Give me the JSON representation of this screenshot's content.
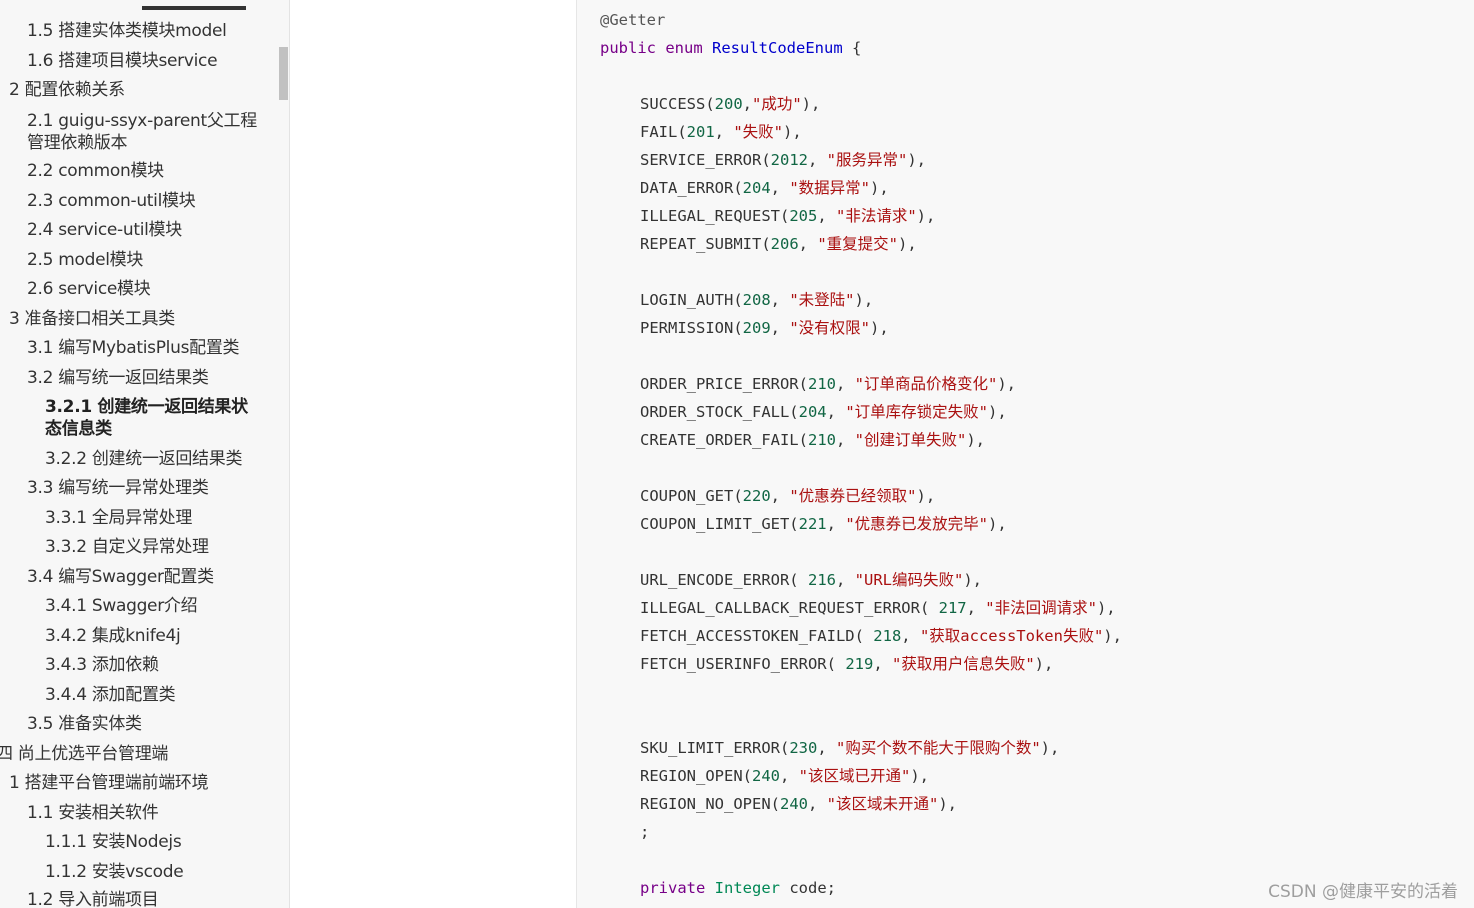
{
  "toc": {
    "items": [
      {
        "label": "1.5 搭建实体类模块model"
      },
      {
        "label": "1.6 搭建项目模块service"
      },
      {
        "label": "2 配置依赖关系"
      },
      {
        "label": "2.1 guigu-ssyx-parent父工程管理依赖版本"
      },
      {
        "label": "2.2 common模块"
      },
      {
        "label": "2.3 common-util模块"
      },
      {
        "label": "2.4 service-util模块"
      },
      {
        "label": "2.5 model模块"
      },
      {
        "label": "2.6 service模块"
      },
      {
        "label": "3 准备接口相关工具类"
      },
      {
        "label": "3.1 编写MybatisPlus配置类"
      },
      {
        "label": "3.2 编写统一返回结果类"
      },
      {
        "label": "3.2.1 创建统一返回结果状态信息类"
      },
      {
        "label": "3.2.2 创建统一返回结果类"
      },
      {
        "label": "3.3 编写统一异常处理类"
      },
      {
        "label": "3.3.1 全局异常处理"
      },
      {
        "label": "3.3.2 自定义异常处理"
      },
      {
        "label": "3.4 编写Swagger配置类"
      },
      {
        "label": "3.4.1 Swagger介绍"
      },
      {
        "label": "3.4.2 集成knife4j"
      },
      {
        "label": "3.4.3 添加依赖"
      },
      {
        "label": "3.4.4 添加配置类"
      },
      {
        "label": "3.5 准备实体类"
      },
      {
        "label": "四 尚上优选平台管理端"
      },
      {
        "label": "1 搭建平台管理端前端环境"
      },
      {
        "label": "1.1 安装相关软件"
      },
      {
        "label": "1.1.1 安装Nodejs"
      },
      {
        "label": "1.1.2 安装vscode"
      },
      {
        "label": "1.2 导入前端项目"
      }
    ]
  },
  "code": {
    "annotation": "@Getter",
    "decl_public": "public",
    "decl_enum": "enum",
    "decl_name": "ResultCodeEnum",
    "decl_brace": "{",
    "entries": [
      {
        "name": "SUCCESS(",
        "num": "200",
        "sep": ",",
        "str": "\"成功\"",
        "end": "),"
      },
      {
        "name": "FAIL(",
        "num": "201",
        "sep": ", ",
        "str": "\"失败\"",
        "end": "),"
      },
      {
        "name": "SERVICE_ERROR(",
        "num": "2012",
        "sep": ", ",
        "str": "\"服务异常\"",
        "end": "),"
      },
      {
        "name": "DATA_ERROR(",
        "num": "204",
        "sep": ", ",
        "str": "\"数据异常\"",
        "end": "),"
      },
      {
        "name": "ILLEGAL_REQUEST(",
        "num": "205",
        "sep": ", ",
        "str": "\"非法请求\"",
        "end": "),"
      },
      {
        "name": "REPEAT_SUBMIT(",
        "num": "206",
        "sep": ", ",
        "str": "\"重复提交\"",
        "end": "),"
      },
      {
        "name": "LOGIN_AUTH(",
        "num": "208",
        "sep": ", ",
        "str": "\"未登陆\"",
        "end": "),"
      },
      {
        "name": "PERMISSION(",
        "num": "209",
        "sep": ", ",
        "str": "\"没有权限\"",
        "end": "),"
      },
      {
        "name": "ORDER_PRICE_ERROR(",
        "num": "210",
        "sep": ", ",
        "str": "\"订单商品价格变化\"",
        "end": "),"
      },
      {
        "name": "ORDER_STOCK_FALL(",
        "num": "204",
        "sep": ", ",
        "str": "\"订单库存锁定失败\"",
        "end": "),"
      },
      {
        "name": "CREATE_ORDER_FAIL(",
        "num": "210",
        "sep": ", ",
        "str": "\"创建订单失败\"",
        "end": "),"
      },
      {
        "name": "COUPON_GET(",
        "num": "220",
        "sep": ", ",
        "str": "\"优惠券已经领取\"",
        "end": "),"
      },
      {
        "name": "COUPON_LIMIT_GET(",
        "num": "221",
        "sep": ", ",
        "str": "\"优惠券已发放完毕\"",
        "end": "),"
      },
      {
        "name": "URL_ENCODE_ERROR( ",
        "num": "216",
        "sep": ", ",
        "str": "\"URL编码失败\"",
        "end": "),"
      },
      {
        "name": "ILLEGAL_CALLBACK_REQUEST_ERROR( ",
        "num": "217",
        "sep": ", ",
        "str": "\"非法回调请求\"",
        "end": "),"
      },
      {
        "name": "FETCH_ACCESSTOKEN_FAILD( ",
        "num": "218",
        "sep": ", ",
        "str": "\"获取accessToken失败\"",
        "end": "),"
      },
      {
        "name": "FETCH_USERINFO_ERROR( ",
        "num": "219",
        "sep": ", ",
        "str": "\"获取用户信息失败\"",
        "end": "),"
      },
      {
        "name": "SKU_LIMIT_ERROR(",
        "num": "230",
        "sep": ", ",
        "str": "\"购买个数不能大于限购个数\"",
        "end": "),"
      },
      {
        "name": "REGION_OPEN(",
        "num": "240",
        "sep": ", ",
        "str": "\"该区域已开通\"",
        "end": "),"
      },
      {
        "name": "REGION_NO_OPEN(",
        "num": "240",
        "sep": ", ",
        "str": "\"该区域未开通\"",
        "end": "),"
      }
    ],
    "terminator": ";",
    "field_private": "private",
    "field_type": "Integer",
    "field_name": "code;"
  },
  "watermark": "CSDN @健康平安的活着",
  "colors": {
    "keyword": "#770088",
    "type": "#0000cc",
    "number": "#116644",
    "string": "#aa1111",
    "sidebar_bg": "#f7f7f7",
    "code_bg": "#f8f8f8"
  }
}
